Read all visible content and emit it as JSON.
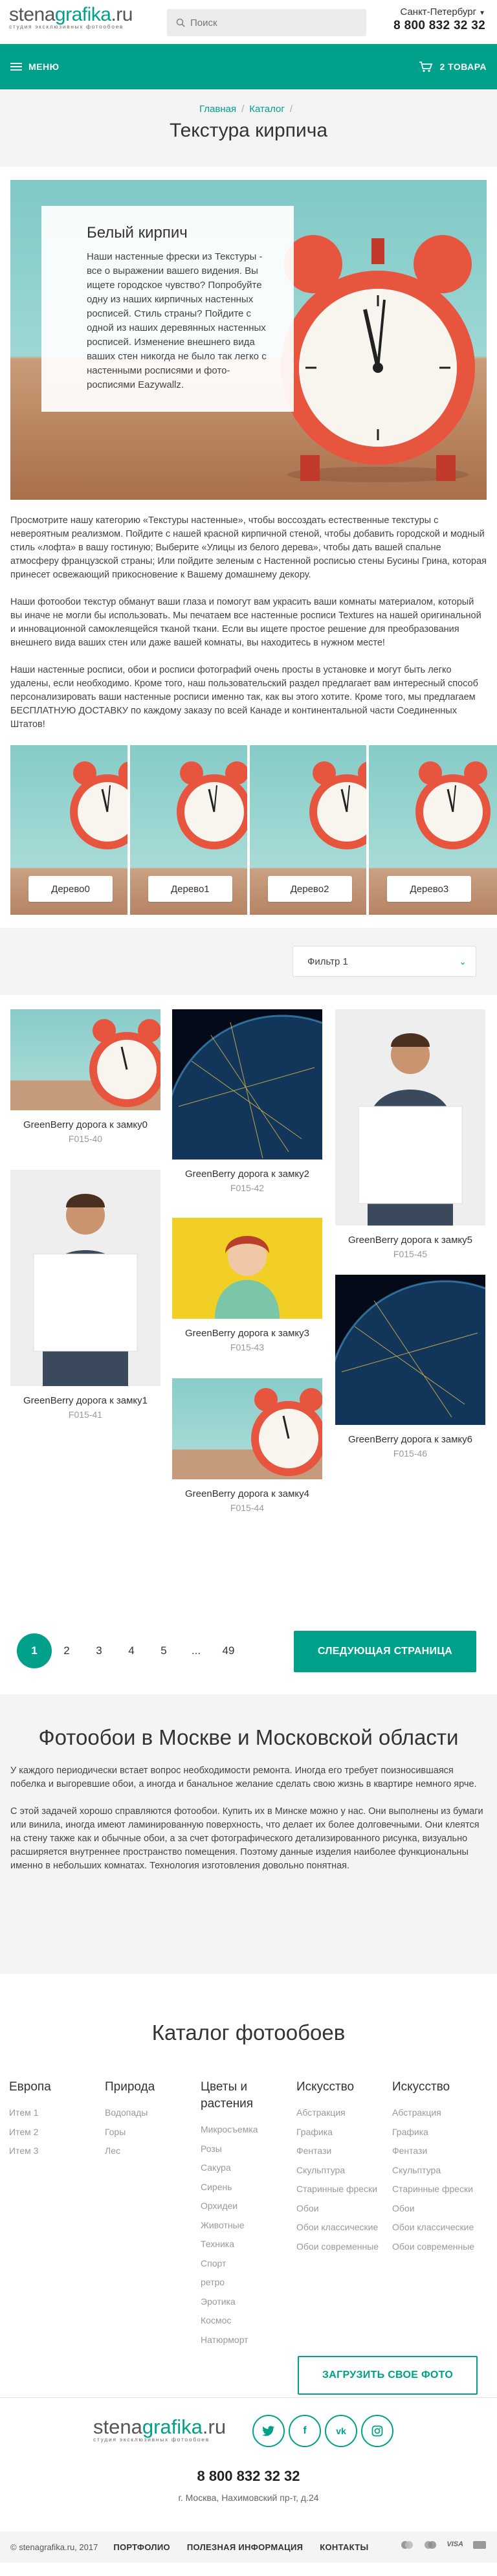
{
  "header": {
    "logo_main": "stena",
    "logo_accent": "grafika",
    "logo_tld": ".ru",
    "logo_tagline": "студия эксклюзивных фотообоев",
    "search_placeholder": "Поиск",
    "city": "Санкт-Петербург",
    "phone": "8 800 832 32 32"
  },
  "navbar": {
    "menu_label": "МЕНЮ",
    "cart_label": "2 ТОВАРА"
  },
  "breadcrumbs": [
    "Главная",
    "Каталог"
  ],
  "page_title": "Текстура кирпича",
  "hero": {
    "title": "Белый кирпич",
    "text": "Наши настенные фрески из Текстуры - все о выражении вашего видения. Вы ищете городское чувство? Попробуйте одну из наших кирпичных настенных росписей. Стиль страны? Пойдите с одной из наших деревянных настенных росписей. Изменение внешнего вида ваших стен никогда не было так легко с настенными росписями и фото-росписями Eazywallz."
  },
  "intro_paragraphs": [
    "Просмотрите нашу категорию «Текстуры настенные», чтобы воссоздать естественные текстуры с невероятным реализмом. Пойдите с нашей красной кирпичной стеной, чтобы добавить городской и модный стиль «лофта» в вашу гостиную; Выберите «Улицы из белого дерева», чтобы дать вашей спальне атмосферу французской страны; Или пойдите зеленым с Настенной росписью стены Бусины Грина, которая принесет освежающий прикосновение к Вашему домашнему декору.",
    "Наши фотообои текстур обманут ваши глаза и помогут вам украсить ваши комнаты материалом, который вы иначе не могли бы использовать. Мы печатаем все настенные росписи Textures на нашей оригинальной и инновационной самоклеящейся тканой ткани. Если вы ищете простое решение для преобразования внешнего вида ваших стен или даже вашей комнаты, вы находитесь в нужном месте!",
    "Наши настенные росписи, обои и росписи фотографий очень просты в установке и могут быть легко удалены, если необходимо. Кроме того, наш пользовательский раздел предлагает вам интересный способ персонализировать ваши настенные росписи именно так, как вы этого хотите. Кроме того, мы предлагаем БЕСПЛАТНУЮ ДОСТАВКУ по каждому заказу по всей Канаде и континентальной части Соединенных Штатов!"
  ],
  "textures": [
    "Дерево0",
    "Дерево1",
    "Дерево2",
    "Дерево3"
  ],
  "filter": {
    "selected": "Фильтр 1"
  },
  "products": [
    {
      "name": "GreenBerry дорога к замку0",
      "code": "F015-40"
    },
    {
      "name": "GreenBerry дорога к замку1",
      "code": "F015-41"
    },
    {
      "name": "GreenBerry дорога к замку2",
      "code": "F015-42"
    },
    {
      "name": "GreenBerry дорога к замку3",
      "code": "F015-43"
    },
    {
      "name": "GreenBerry дорога к замку4",
      "code": "F015-44"
    },
    {
      "name": "GreenBerry дорога к замку5",
      "code": "F015-45"
    },
    {
      "name": "GreenBerry дорога к замку6",
      "code": "F015-46"
    }
  ],
  "pagination": {
    "pages": [
      "1",
      "2",
      "3",
      "4",
      "5",
      "...",
      "49"
    ],
    "current": "1",
    "next_label": "СЛЕДУЮЩАЯ СТРАНИЦА"
  },
  "seo": {
    "title": "Фотообои в Москве и Московской области",
    "paragraphs": [
      "У каждого периодически встает вопрос необходимости ремонта. Иногда его требует поизносившаяся побелка и выгоревшие обои, а иногда и банальное желание сделать свою жизнь в квартире немного ярче.",
      "С этой задачей хорошо справляются фотообои. Купить их в Минске можно у нас. Они выполнены из бумаги или винила, иногда имеют ламинированную поверхность, что делает их более долговечными. Они клеятся на стену также как и обычные обои, а за счет фотографического детализированного рисунка, визуально расширяется внутреннее пространство помещения. Поэтому данные изделия наиболее функциональны именно в небольших комнатах. Технология изготовления довольно понятная."
    ]
  },
  "catalog": {
    "title": "Каталог фотообоев",
    "columns": [
      {
        "head": "Европа",
        "items": [
          "Итем 1",
          "Итем 2",
          "Итем 3"
        ]
      },
      {
        "head": "Природа",
        "items": [
          "Водопады",
          "Горы",
          "Лес"
        ]
      },
      {
        "head": "Цветы и растения",
        "items": [
          "Микросъемка",
          "Розы",
          "Сакура",
          "Сирень",
          "Орхидеи",
          "Животные",
          "Техника",
          "Спорт",
          "ретро",
          "Эротика",
          "Космос",
          "Натюрморт"
        ]
      },
      {
        "head": "Искусство",
        "items": [
          "Абстракция",
          "Графика",
          "Фентази",
          "Скульптура",
          "Старинные фрески",
          "Обои",
          "Обои классические",
          "Обои современные"
        ]
      },
      {
        "head": "Искусство",
        "items": [
          "Абстракция",
          "Графика",
          "Фентази",
          "Скульптура",
          "Старинные фрески",
          "Обои",
          "Обои классические",
          "Обои современные"
        ]
      }
    ],
    "upload_label": "ЗАГРУЗИТЬ СВОЕ ФОТО"
  },
  "footer": {
    "social": [
      "twitter-icon",
      "facebook-icon",
      "vk-icon",
      "instagram-icon"
    ],
    "phone": "8 800 832 32 32",
    "address": "г. Москва, Нахимовский пр-т, д.24",
    "copyright": "© stenagrafika.ru, 2017",
    "links": [
      "ПОРТФОЛИО",
      "ПОЛЕЗНАЯ ИНФОРМАЦИЯ",
      "КОНТАКТЫ"
    ],
    "payments": [
      "",
      "",
      "VISA",
      ""
    ]
  },
  "colors": {
    "accent": "#00a08a",
    "clock_red": "#e8553f",
    "sky": "#8fd0cc"
  }
}
